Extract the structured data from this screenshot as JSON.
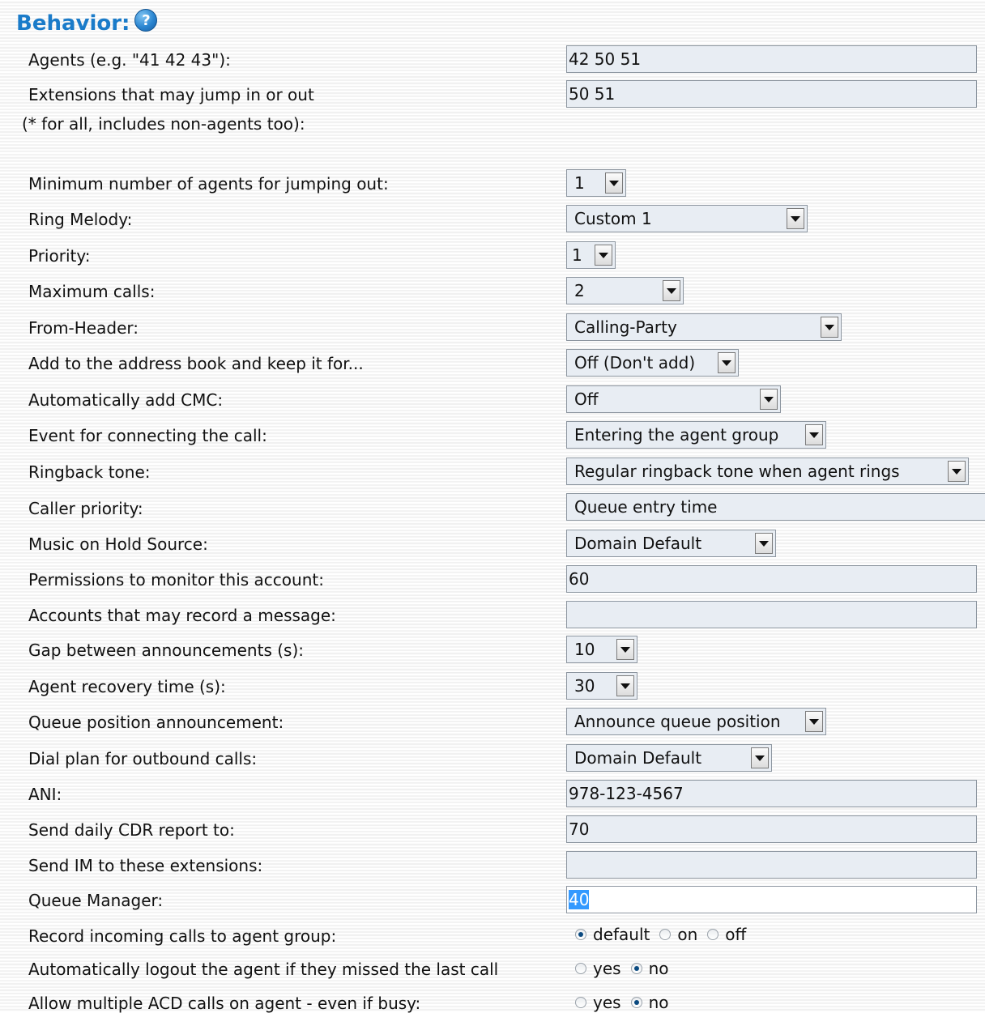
{
  "section": {
    "title": "Behavior:",
    "help_icon": "question-circle-icon",
    "help_glyph": "?"
  },
  "rows": {
    "agents": {
      "label": "Agents (e.g. \"41 42 43\"):",
      "value": "42 50 51"
    },
    "extensions_jump": {
      "label": "Extensions that may jump in or out",
      "label2": "(* for all, includes non-agents too):",
      "value": "50 51"
    },
    "min_agents": {
      "label": "Minimum number of agents for jumping out:",
      "value": "1"
    },
    "ring_melody": {
      "label": "Ring Melody:",
      "value": "Custom 1"
    },
    "priority": {
      "label": "Priority:",
      "value": "1"
    },
    "max_calls": {
      "label": "Maximum calls:",
      "value": "2"
    },
    "from_header": {
      "label": "From-Header:",
      "value": "Calling-Party"
    },
    "address_book": {
      "label": "Add to the address book and keep it for...",
      "value": "Off (Don't add)"
    },
    "cmc": {
      "label": "Automatically add CMC:",
      "value": "Off"
    },
    "connect_event": {
      "label": "Event for connecting the call:",
      "value": "Entering the agent group"
    },
    "ringback": {
      "label": "Ringback tone:",
      "value": "Regular ringback tone when agent rings"
    },
    "caller_priority": {
      "label": "Caller priority:",
      "value": "Queue entry time"
    },
    "moh": {
      "label": "Music on Hold Source:",
      "value": "Domain Default"
    },
    "monitor_perm": {
      "label": "Permissions to monitor this account:",
      "value": "60"
    },
    "record_msg": {
      "label": "Accounts that may record a message:",
      "value": ""
    },
    "gap": {
      "label": "Gap between announcements (s):",
      "value": "10"
    },
    "recovery": {
      "label": "Agent recovery time (s):",
      "value": "30"
    },
    "queue_pos": {
      "label": "Queue position announcement:",
      "value": "Announce queue position"
    },
    "dial_plan": {
      "label": "Dial plan for outbound calls:",
      "value": "Domain Default"
    },
    "ani": {
      "label": "ANI:",
      "value": "978-123-4567"
    },
    "cdr": {
      "label": "Send daily CDR report to:",
      "value": "70"
    },
    "im": {
      "label": "Send IM to these extensions:",
      "value": ""
    },
    "queue_manager": {
      "label": "Queue Manager:",
      "value": "40"
    },
    "record_incoming": {
      "label": "Record incoming calls to agent group:",
      "options": [
        "default",
        "on",
        "off"
      ],
      "selected": "default"
    },
    "auto_logout": {
      "label": "Automatically logout the agent if they missed the last call",
      "options": [
        "yes",
        "no"
      ],
      "selected": "no"
    },
    "multi_acd": {
      "label": "Allow multiple ACD calls on agent - even if busy:",
      "options": [
        "yes",
        "no"
      ],
      "selected": "no"
    }
  },
  "colors": {
    "title": "#1a7bc9",
    "field_bg": "#e8edf3",
    "field_border": "#8d96a0",
    "selection": "#3399ff"
  }
}
